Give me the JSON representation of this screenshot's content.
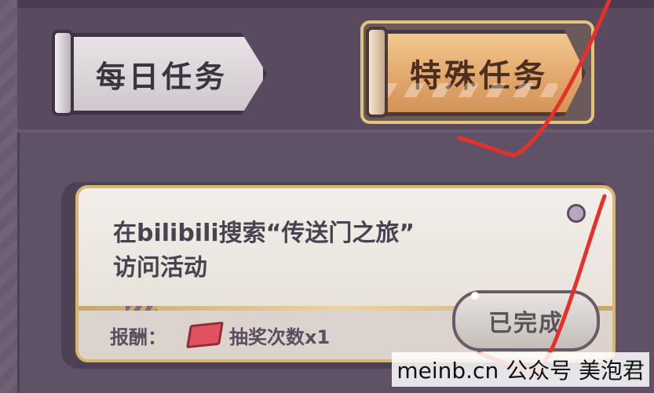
{
  "tabs": [
    {
      "label": "每日任务",
      "selected": false
    },
    {
      "label": "特殊任务",
      "selected": true
    }
  ],
  "task": {
    "title_line1": "在bilibili搜索“传送门之旅”",
    "title_line2": "访问活动",
    "reward_label": "报酬：",
    "reward_icon": "ticket-icon",
    "reward_text": "抽奖次数x1",
    "status_button": "已完成"
  },
  "watermark": "meinb.cn 公众号 美泡君",
  "colors": {
    "background": "#5f5166",
    "card_border": "#d8b66e",
    "selected_tab": "#e0a569",
    "annotation": "#e8302a"
  }
}
